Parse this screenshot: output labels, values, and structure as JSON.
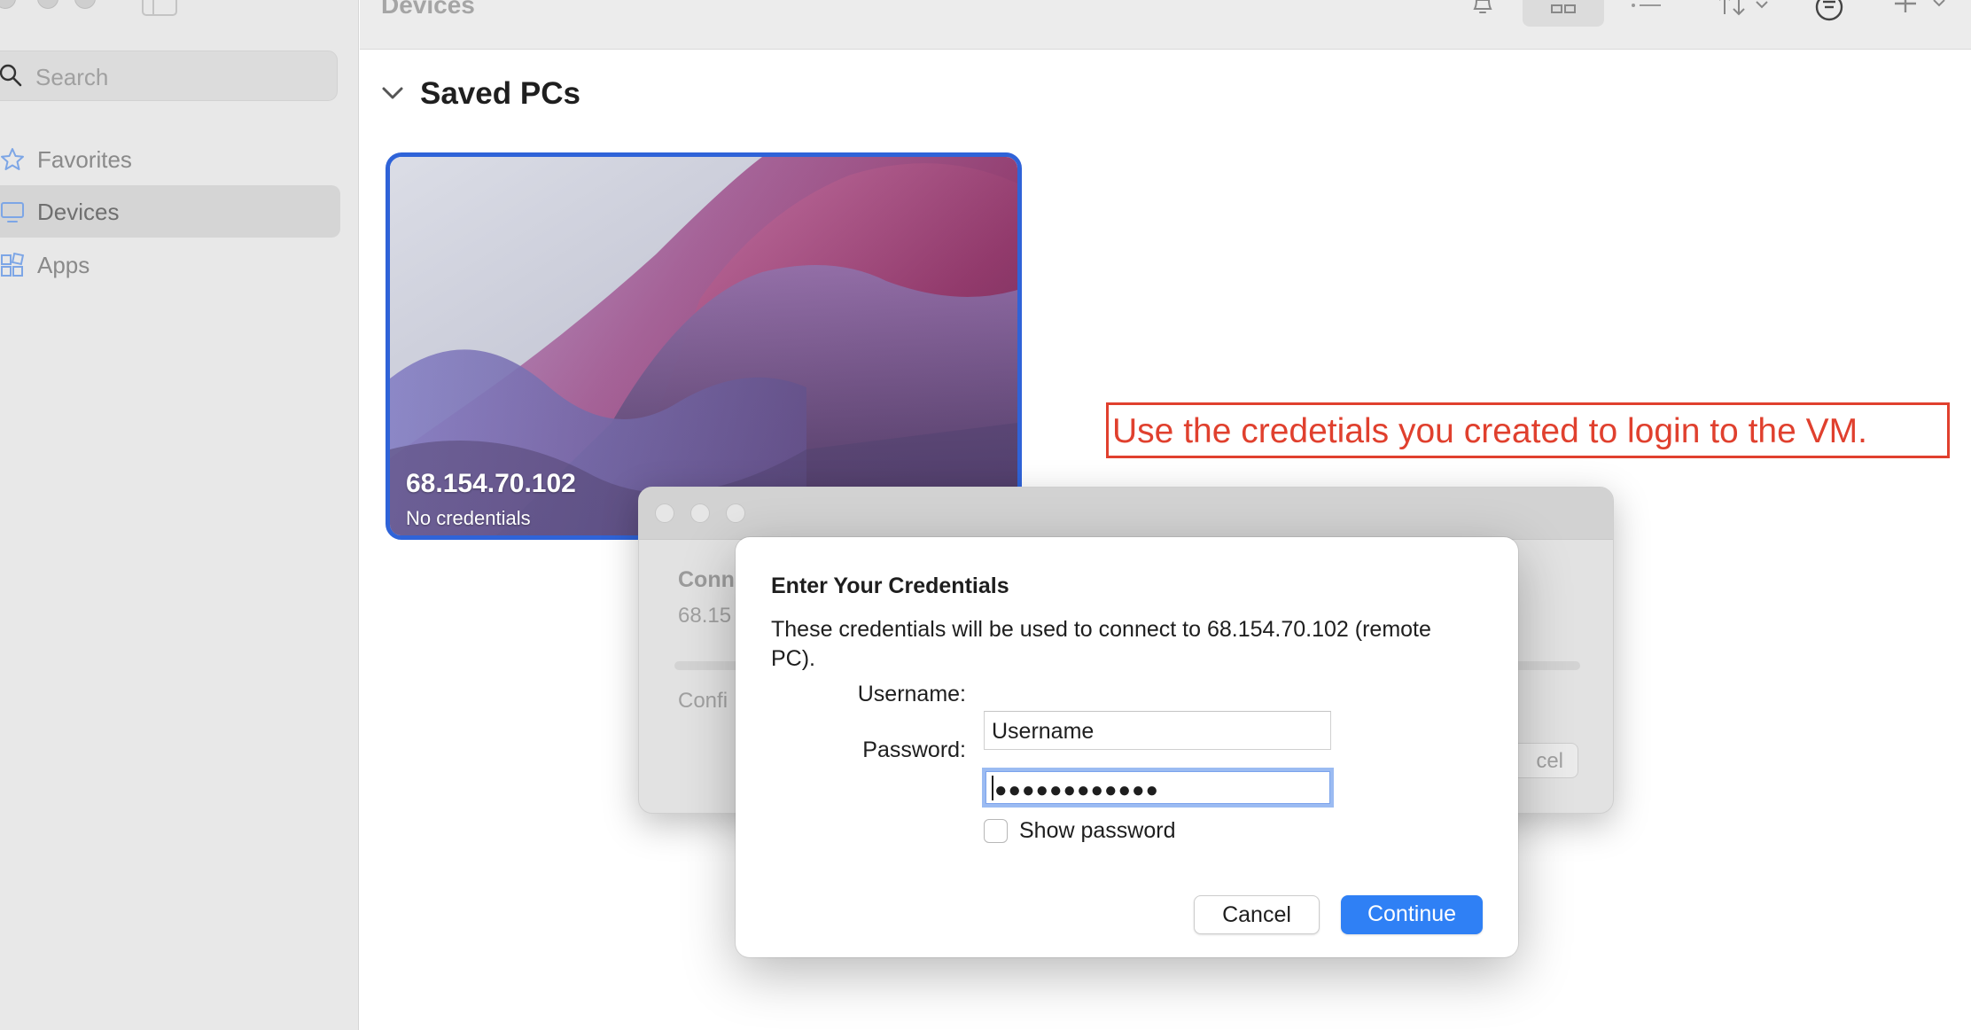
{
  "toolbar": {
    "title": "Devices",
    "icons": [
      "bell-icon",
      "grid-view-icon",
      "list-view-icon",
      "sort-icon",
      "filter-icon",
      "add-icon"
    ]
  },
  "sidebar": {
    "search_placeholder": "Search",
    "items": [
      {
        "label": "Favorites",
        "icon": "star-icon",
        "active": false
      },
      {
        "label": "Devices",
        "icon": "monitor-icon",
        "active": true
      },
      {
        "label": "Apps",
        "icon": "apps-icon",
        "active": false
      }
    ]
  },
  "content": {
    "section_title": "Saved PCs",
    "pc": {
      "address": "68.154.70.102",
      "status": "No credentials"
    }
  },
  "annotation": {
    "text": "Use the credetials you created to login to the VM."
  },
  "background_window": {
    "heading": "Conn",
    "address": "68.15",
    "status": "Confi",
    "cancel_label": "cel"
  },
  "dialog": {
    "title": "Enter Your Credentials",
    "message": "These credentials will be used to connect to 68.154.70.102 (remote PC).",
    "username_label": "Username:",
    "username_value": "Username",
    "password_label": "Password:",
    "password_value": "●●●●●●●●●●●●",
    "show_password_label": "Show password",
    "show_password_checked": false,
    "cancel_label": "Cancel",
    "continue_label": "Continue"
  },
  "colors": {
    "accent": "#2f80f5",
    "annotation": "#e0402e",
    "card_border": "#2f63d8"
  }
}
